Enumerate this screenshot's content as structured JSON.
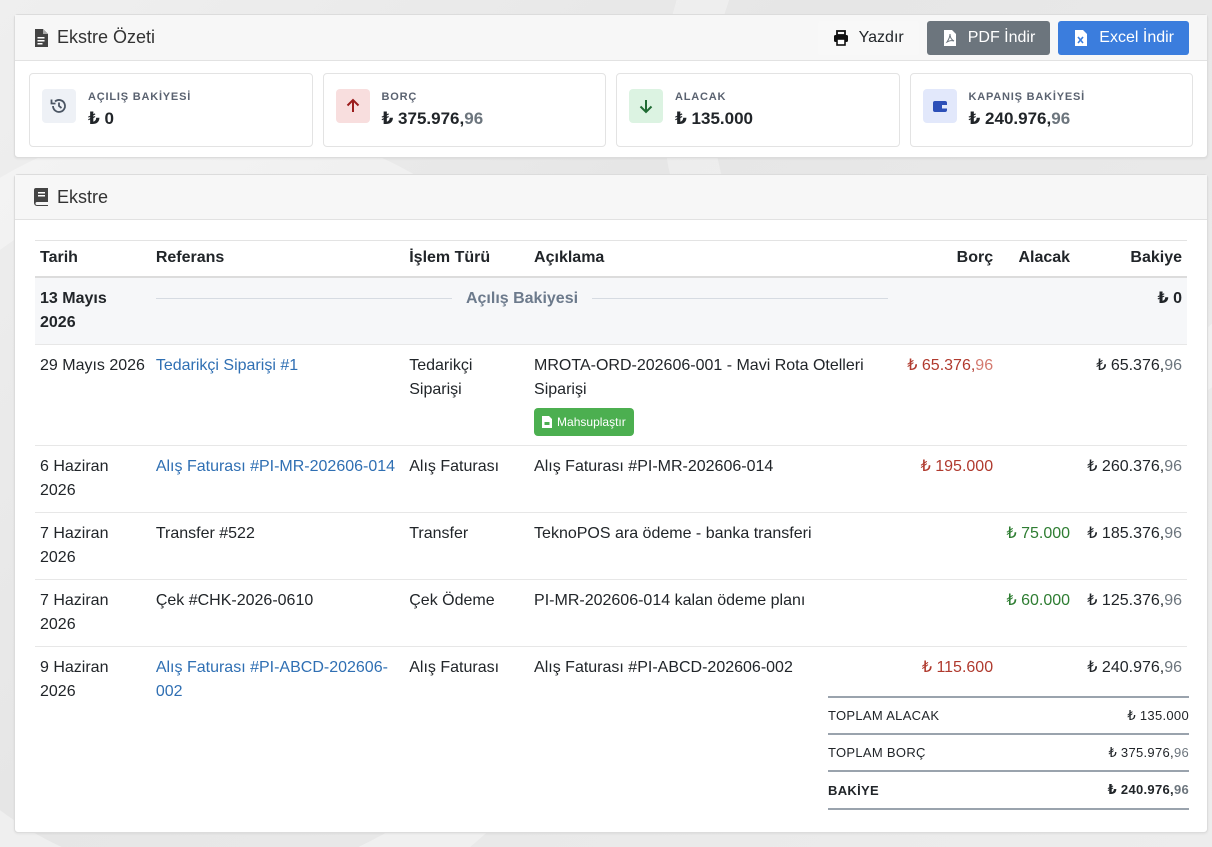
{
  "summary_card": {
    "title": "Ekstre Özeti",
    "buttons": {
      "print": "Yazdır",
      "pdf": "PDF İndir",
      "excel": "Excel İndir"
    },
    "boxes": [
      {
        "label": "AÇILIŞ BAKİYESİ",
        "value_int": "₺ 0",
        "value_dec": "",
        "icon": "history-icon",
        "color": "#eef1f6"
      },
      {
        "label": "BORÇ",
        "value_int": "₺ 375.976,",
        "value_dec": "96",
        "icon": "arrow-up-icon",
        "color": "#f8dede"
      },
      {
        "label": "ALACAK",
        "value_int": "₺ 135.000",
        "value_dec": "",
        "icon": "arrow-down-icon",
        "color": "#dcf3e2"
      },
      {
        "label": "KAPANIŞ BAKİYESİ",
        "value_int": "₺ 240.976,",
        "value_dec": "96",
        "icon": "wallet-icon",
        "color": "#e2e8fb"
      }
    ]
  },
  "statement": {
    "title": "Ekstre",
    "columns": {
      "date": "Tarih",
      "ref": "Referans",
      "type": "İşlem Türü",
      "desc": "Açıklama",
      "debt": "Borç",
      "credit": "Alacak",
      "balance": "Bakiye"
    },
    "opening": {
      "date": "13 Mayıs 2026",
      "label": "Açılış Bakiyesi",
      "balance": "₺ 0"
    },
    "rows": [
      {
        "date": "29 Mayıs 2026",
        "ref": "Tedarikçi Siparişi #1",
        "type": "Tedarikçi Siparişi",
        "desc": "MROTA-ORD-202606-001 - Mavi Rota Otelleri Siparişi",
        "debt_int": "₺ 65.376,",
        "debt_dec": "96",
        "credit": "",
        "bal_int": "₺ 65.376,",
        "bal_dec": "96",
        "action": "Mahsuplaştır"
      },
      {
        "date": "6 Haziran 2026",
        "ref": "Alış Faturası #PI-MR-202606-014",
        "type": "Alış Faturası",
        "desc": "Alış Faturası #PI-MR-202606-014",
        "debt_int": "₺ 195.000",
        "debt_dec": "",
        "credit": "",
        "bal_int": "₺ 260.376,",
        "bal_dec": "96"
      },
      {
        "date": "7 Haziran 2026",
        "ref": "Transfer #522",
        "type": "Transfer",
        "desc": "TeknoPOS ara ödeme - banka transferi",
        "debt_int": "",
        "debt_dec": "",
        "credit": "₺ 75.000",
        "bal_int": "₺ 185.376,",
        "bal_dec": "96"
      },
      {
        "date": "7 Haziran 2026",
        "ref": "Çek #CHK-2026-0610",
        "type": "Çek Ödeme",
        "desc": "PI-MR-202606-014 kalan ödeme planı",
        "debt_int": "",
        "debt_dec": "",
        "credit": "₺ 60.000",
        "bal_int": "₺ 125.376,",
        "bal_dec": "96"
      },
      {
        "date": "9 Haziran 2026",
        "ref": "Alış Faturası #PI-ABCD-202606-002",
        "type": "Alış Faturası",
        "desc": "Alış Faturası #PI-ABCD-202606-002",
        "debt_int": "₺ 115.600",
        "debt_dec": "",
        "credit": "",
        "bal_int": "₺ 240.976,",
        "bal_dec": "96"
      }
    ],
    "totals": [
      {
        "label": "TOPLAM ALACAK",
        "int": "₺ 135.000",
        "dec": ""
      },
      {
        "label": "TOPLAM BORÇ",
        "int": "₺ 375.976,",
        "dec": "96"
      },
      {
        "label": "BAKİYE",
        "int": "₺ 240.976,",
        "dec": "96"
      }
    ]
  }
}
